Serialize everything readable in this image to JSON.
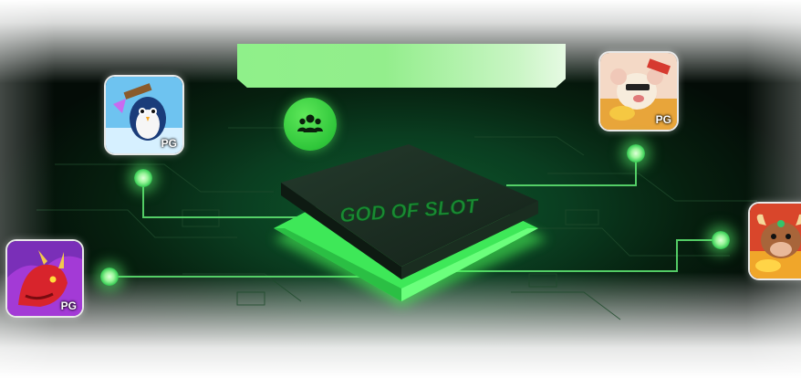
{
  "banner": {
    "title": ""
  },
  "chip": {
    "logo_text": "GOD OF SLOT"
  },
  "badge": {
    "icon": "users-group-icon"
  },
  "games": [
    {
      "id": "penguin",
      "icon": "penguin-game-icon",
      "provider": "PG"
    },
    {
      "id": "dragon",
      "icon": "dragon-game-icon",
      "provider": "PG"
    },
    {
      "id": "fortune-mouse",
      "icon": "fortune-character-game-icon",
      "provider": "PG"
    },
    {
      "id": "fortune-ox",
      "icon": "fortune-ox-game-icon",
      "provider": ""
    }
  ],
  "colors": {
    "accent": "#3fd05a",
    "banner": "#93ee8c",
    "glow": "#4cff5a",
    "background": "#06200f"
  }
}
